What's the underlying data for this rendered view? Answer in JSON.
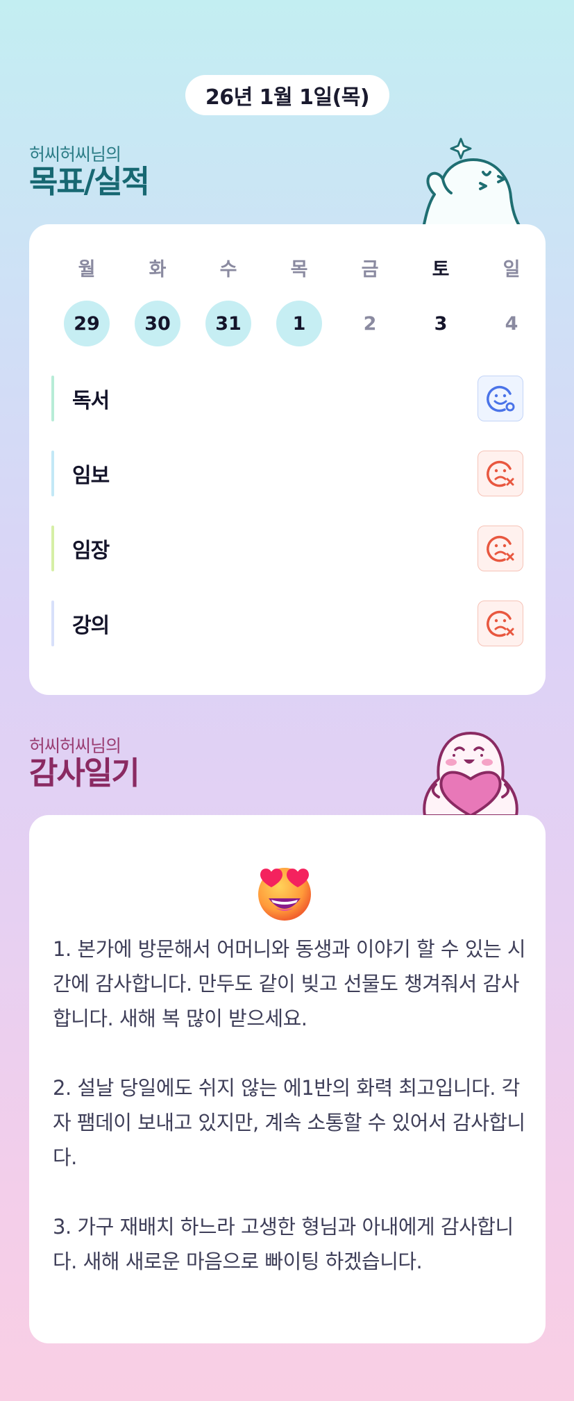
{
  "header": {
    "date": "26년 1월 1일(목)"
  },
  "goals_section": {
    "subtitle": "허씨허씨님의",
    "title": "목표/실적",
    "week": [
      {
        "day": "월",
        "num": "29",
        "done": true
      },
      {
        "day": "화",
        "num": "30",
        "done": true
      },
      {
        "day": "수",
        "num": "31",
        "done": true
      },
      {
        "day": "목",
        "num": "1",
        "done": true
      },
      {
        "day": "금",
        "num": "2",
        "done": false
      },
      {
        "day": "토",
        "num": "3",
        "done": false
      },
      {
        "day": "일",
        "num": "4",
        "done": false
      }
    ],
    "goals": [
      {
        "label": "독서",
        "status": "achieved",
        "bar_color": "#b7ecd7"
      },
      {
        "label": "임보",
        "status": "missed",
        "bar_color": "#c3e8f6"
      },
      {
        "label": "임장",
        "status": "missed",
        "bar_color": "#d6efa6"
      },
      {
        "label": "강의",
        "status": "missed",
        "bar_color": "#d8e0fa"
      }
    ],
    "icons": {
      "achieved": "smile-check-icon",
      "missed": "frown-x-icon"
    }
  },
  "thanks_section": {
    "subtitle": "허씨허씨님의",
    "title": "감사일기",
    "emoji": "heart-eyes-emoji-icon",
    "text": "1. 본가에 방문해서 어머니와 동생과 이야기 할 수 있는 시간에 감사합니다. 만두도 같이 빚고 선물도 챙겨줘서 감사합니다. 새해 복 많이 받으세요.\n\n2. 설날 당일에도 쉬지 않는 에1반의 화력 최고입니다. 각자 팸데이 보내고 있지만, 계속 소통할 수 있어서 감사합니다.\n\n3. 가구 재배치 하느라 고생한 형님과 아내에게 감사합니다. 새해 새로운 마음으로 빠이팅 하겠습니다."
  },
  "colors": {
    "done_day": "#c6eef3",
    "achieved_icon": "#4a73e8",
    "missed_icon": "#e8573f",
    "goal_title": "#176872",
    "thanks_title": "#8a2a62"
  }
}
